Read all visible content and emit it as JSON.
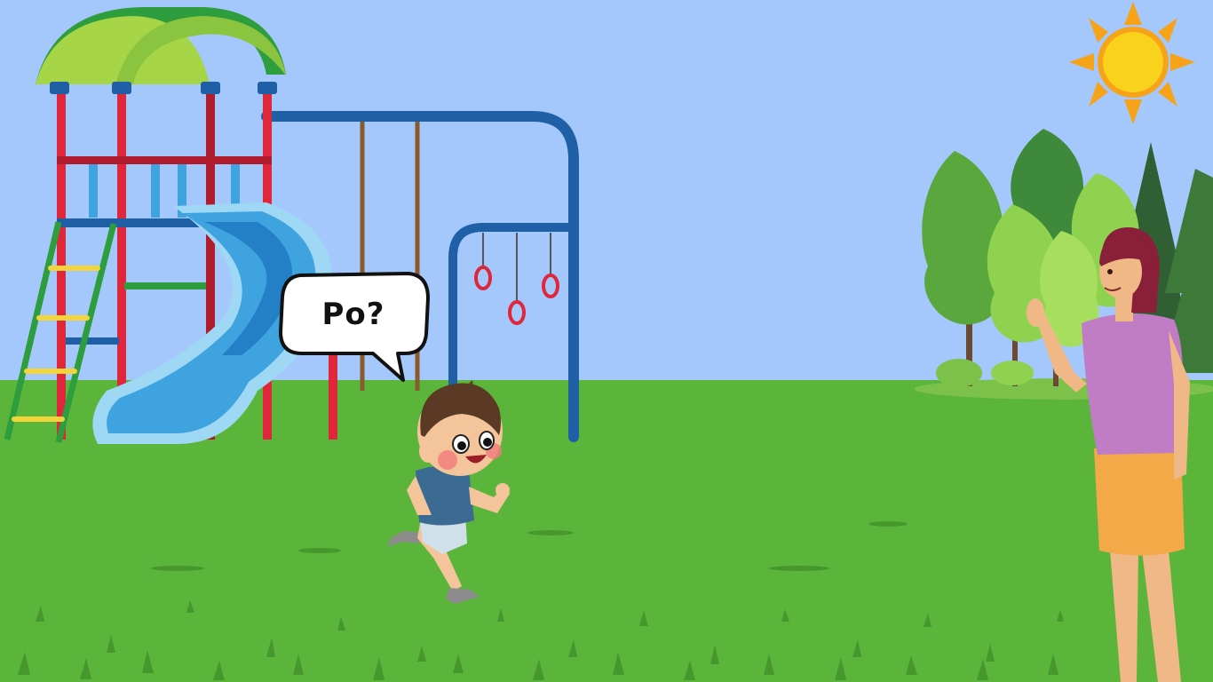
{
  "speech_bubble": {
    "text": "Po?"
  },
  "colors": {
    "sky": "#a4c8fb",
    "grass": "#5bb53a",
    "grass_dark": "#3f8f2a",
    "slide": "#3fa3e0",
    "frame_blue": "#1f5fa6",
    "frame_red": "#e0263b",
    "roof_green": "#8bc53f",
    "sun": "#f9d21b",
    "woman_top": "#c17cc6",
    "woman_skirt": "#f4a948",
    "boy_shirt": "#3b6a92"
  },
  "icons": [
    "sun-icon",
    "trees-group",
    "playground-structure",
    "boy-figure",
    "woman-figure",
    "speech-bubble"
  ]
}
